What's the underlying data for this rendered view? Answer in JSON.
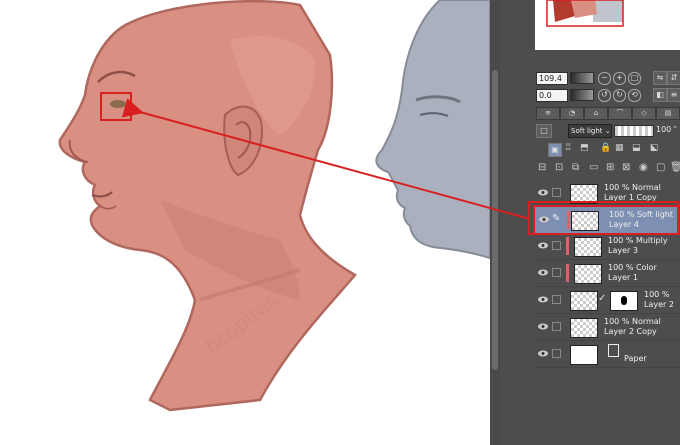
{
  "colors": {
    "skin": "#d98f82",
    "gray": "#aab0bd",
    "accent": "#d91f1f",
    "selected_layer": "#7d8fb2",
    "color_label": "#e06070"
  },
  "watermark": "ficopires",
  "navigator": {
    "zoom": "109.4",
    "rotation": "0.0"
  },
  "layer_props": {
    "blend_mode": "Soft light",
    "opacity": "100"
  },
  "layers": [
    {
      "opacity_mode": "100 % Normal",
      "name": "Layer 1 Copy",
      "selected": false
    },
    {
      "opacity_mode": "100 % Soft light",
      "name": "Layer 4",
      "selected": true
    },
    {
      "opacity_mode": "100 % Multiply",
      "name": "Layer 3",
      "selected": false
    },
    {
      "opacity_mode": "100 % Color",
      "name": "Layer 1",
      "selected": false
    },
    {
      "opacity_mode": "100 %",
      "name": "Layer 2",
      "selected": false
    },
    {
      "opacity_mode": "100 % Normal",
      "name": "Layer 2 Copy",
      "selected": false
    },
    {
      "opacity_mode": "",
      "name": "Paper",
      "selected": false
    }
  ]
}
